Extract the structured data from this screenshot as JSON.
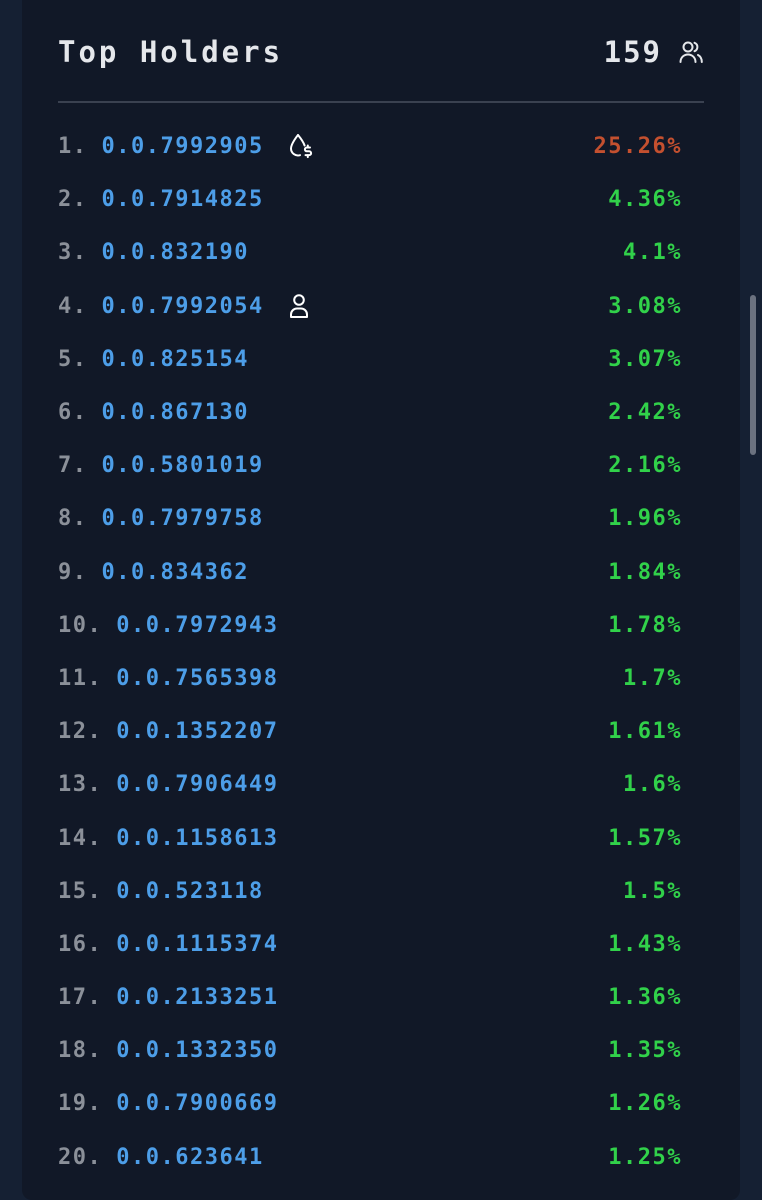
{
  "header": {
    "title": "Top Holders",
    "count": "159",
    "icon": "users-icon"
  },
  "holders": [
    {
      "rank": "1.",
      "address": "0.0.7992905",
      "percent": "25.26%",
      "icon": "liquidity-drop-dollar-icon",
      "color": "#c4502f"
    },
    {
      "rank": "2.",
      "address": "0.0.7914825",
      "percent": "4.36%"
    },
    {
      "rank": "3.",
      "address": "0.0.832190",
      "percent": "4.1%"
    },
    {
      "rank": "4.",
      "address": "0.0.7992054",
      "percent": "3.08%",
      "icon": "user-icon"
    },
    {
      "rank": "5.",
      "address": "0.0.825154",
      "percent": "3.07%"
    },
    {
      "rank": "6.",
      "address": "0.0.867130",
      "percent": "2.42%"
    },
    {
      "rank": "7.",
      "address": "0.0.5801019",
      "percent": "2.16%"
    },
    {
      "rank": "8.",
      "address": "0.0.7979758",
      "percent": "1.96%"
    },
    {
      "rank": "9.",
      "address": "0.0.834362",
      "percent": "1.84%"
    },
    {
      "rank": "10.",
      "address": "0.0.7972943",
      "percent": "1.78%"
    },
    {
      "rank": "11.",
      "address": "0.0.7565398",
      "percent": "1.7%"
    },
    {
      "rank": "12.",
      "address": "0.0.1352207",
      "percent": "1.61%"
    },
    {
      "rank": "13.",
      "address": "0.0.7906449",
      "percent": "1.6%"
    },
    {
      "rank": "14.",
      "address": "0.0.1158613",
      "percent": "1.57%"
    },
    {
      "rank": "15.",
      "address": "0.0.523118",
      "percent": "1.5%"
    },
    {
      "rank": "16.",
      "address": "0.0.1115374",
      "percent": "1.43%"
    },
    {
      "rank": "17.",
      "address": "0.0.2133251",
      "percent": "1.36%"
    },
    {
      "rank": "18.",
      "address": "0.0.1332350",
      "percent": "1.35%"
    },
    {
      "rank": "19.",
      "address": "0.0.7900669",
      "percent": "1.26%"
    },
    {
      "rank": "20.",
      "address": "0.0.623641",
      "percent": "1.25%"
    }
  ],
  "colors": {
    "background": "#111827",
    "address": "#4d9ee8",
    "percent": "#31d14a",
    "percent_top": "#c4502f",
    "rank": "#8b9099"
  }
}
